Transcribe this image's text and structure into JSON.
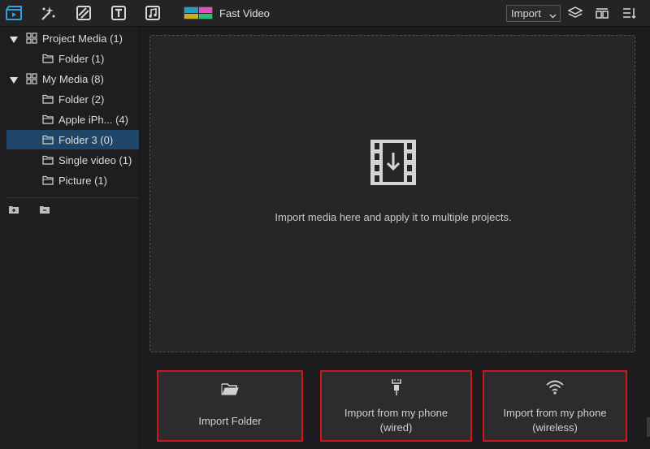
{
  "toolbar": {
    "tools": [
      "media-icon",
      "effects-icon",
      "transitions-icon",
      "titles-icon",
      "audio-icon"
    ],
    "project_tab": {
      "title": "Fast Video",
      "logo_colors": [
        "#1aa3c9",
        "#e94cc0",
        "#c9b021",
        "#2fbf71"
      ]
    },
    "import_select": {
      "value": "Import"
    },
    "right_icons": [
      "layers-icon",
      "split-view-icon",
      "sort-list-icon"
    ]
  },
  "sidebar": {
    "items": [
      {
        "label": "Project Media (1)",
        "level": 0,
        "expanded": true,
        "icon": "grid-icon"
      },
      {
        "label": "Folder (1)",
        "level": 1,
        "icon": "folder-icon"
      },
      {
        "label": "My Media (8)",
        "level": 0,
        "expanded": true,
        "icon": "grid-icon"
      },
      {
        "label": "Folder (2)",
        "level": 1,
        "icon": "folder-icon"
      },
      {
        "label": "Apple iPh... (4)",
        "level": 1,
        "icon": "folder-icon"
      },
      {
        "label": "Folder 3 (0)",
        "level": 1,
        "icon": "folder-icon",
        "selected": true
      },
      {
        "label": "Single video (1)",
        "level": 1,
        "icon": "folder-icon"
      },
      {
        "label": "Picture (1)",
        "level": 1,
        "icon": "folder-icon"
      }
    ],
    "actions": [
      "add-folder-icon",
      "remove-folder-icon"
    ]
  },
  "dropzone": {
    "icon": "film-import-icon",
    "message": "Import media here and apply it to multiple projects."
  },
  "import_options": [
    {
      "icon": "folder-open-icon",
      "lines": [
        "Import Folder"
      ]
    },
    {
      "icon": "usb-cable-icon",
      "lines": [
        "Import from my phone",
        "(wired)"
      ]
    },
    {
      "icon": "wifi-icon",
      "lines": [
        "Import from my phone",
        "(wireless)"
      ]
    }
  ],
  "colors": {
    "highlight_border": "#d0151b",
    "selected_row": "#1f4568",
    "accent_blue": "#2fa0e0"
  }
}
